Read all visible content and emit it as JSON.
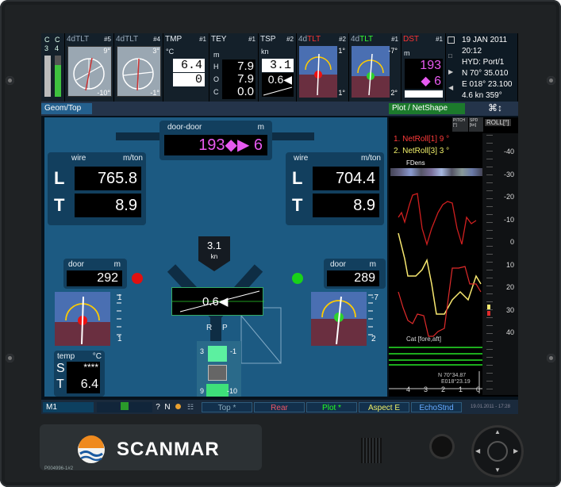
{
  "top_bar": {
    "c_labels": [
      "C",
      "C",
      "3",
      "4"
    ],
    "sensors": [
      {
        "title": "4dTLT",
        "num": "#5",
        "top_value": "9°",
        "bottom_value": "-10°"
      },
      {
        "title": "4dTLT",
        "num": "#4",
        "top_value": "3°",
        "bottom_value": "-1°"
      }
    ],
    "tmp": {
      "title": "TMP",
      "num": "#1",
      "unit": "°C",
      "value1": "6.4",
      "value2": "0"
    },
    "tey": {
      "title": "TEY",
      "num": "#1",
      "unit_letters": [
        "m",
        "H",
        "O",
        "C"
      ],
      "values": [
        "7.9",
        "7.9",
        "0.0"
      ]
    },
    "tsp": {
      "title": "TSP",
      "num": "#2",
      "unit": "kn",
      "value1": "3.1",
      "value2": "0.6◀"
    },
    "tlt_red": {
      "title_prefix": "4d",
      "title": "TLT",
      "num": "#2",
      "top_value": "1°",
      "bottom_value": "1°"
    },
    "tlt_green": {
      "title_prefix": "4d",
      "title": "TLT",
      "num": "#1",
      "top_value": "-7°",
      "bottom_value": "2°"
    },
    "dst": {
      "title": "DST",
      "num": "#1",
      "unit": "m",
      "value1": "193",
      "value2": "◆ 6"
    },
    "info": {
      "date": "19 JAN 2011",
      "time": "20:12",
      "hyd": "HYD: Port/1",
      "north": "N  70° 35.010",
      "east": "E 018° 23.100",
      "speed": "4.6 kn   359°"
    }
  },
  "strip": {
    "left_tab": "Geom/Top",
    "right_tab": "Plot / NetShape",
    "icon_text": "⌘↕"
  },
  "door_door": {
    "label": "door-door",
    "unit": "m",
    "value": "193◆▶ 6"
  },
  "wire_left": {
    "label": "wire",
    "unit": "m/ton",
    "L": "765.8",
    "T": "8.9"
  },
  "wire_right": {
    "label": "wire",
    "unit": "m/ton",
    "L": "704.4",
    "T": "8.9"
  },
  "speed_box": {
    "value": "3.1",
    "unit": "kn"
  },
  "door_left": {
    "label": "door",
    "unit": "m",
    "value": "292"
  },
  "door_right": {
    "label": "door",
    "unit": "m",
    "value": "289"
  },
  "sensor_left": {
    "v1": "1",
    "v2": "1"
  },
  "sensor_right": {
    "v1": "-7",
    "v2": "2"
  },
  "center_trim": {
    "value": "0.6◀"
  },
  "rp_labels": {
    "r": "R",
    "p": "P"
  },
  "temp_box": {
    "label": "temp",
    "unit": "°C",
    "s_label": "S",
    "s_value": "****",
    "t_label": "T",
    "t_value": "6.4"
  },
  "trawl": {
    "left_values": [
      "3",
      "9"
    ],
    "right_values": [
      "-1",
      "-10"
    ]
  },
  "plot": {
    "header_small": [
      "PITCH [°]",
      "SPD [kn]"
    ],
    "roll_label": "ROLL[°]",
    "legend": [
      {
        "text": "1. NetRoll[1] 9 °",
        "color": "#ff3a3a"
      },
      {
        "text": "2. NetRoll[3] 3 °",
        "color": "#f1f06a"
      }
    ],
    "fdens_label": "FDens",
    "cat_label": "Cat [fore,aft]",
    "roll_ticks": [
      "-40",
      "-30",
      "-20",
      "-10",
      "0",
      "10",
      "20",
      "30",
      "40"
    ],
    "pos_n": "N  70°34.87",
    "pos_e": "E018°23.19",
    "bottom_ticks": [
      "4",
      "3",
      "2",
      "1",
      "0"
    ]
  },
  "bottom_bar": {
    "m1": "M1",
    "q": "?",
    "n": "N",
    "tabs": [
      "Top *",
      "Rear",
      "Plot *",
      "Aspect E",
      "EchoStnd"
    ],
    "date": "19.01.2011 - 17:28"
  },
  "brand": {
    "name": "SCANMAR",
    "part": "P004996-1#2"
  }
}
